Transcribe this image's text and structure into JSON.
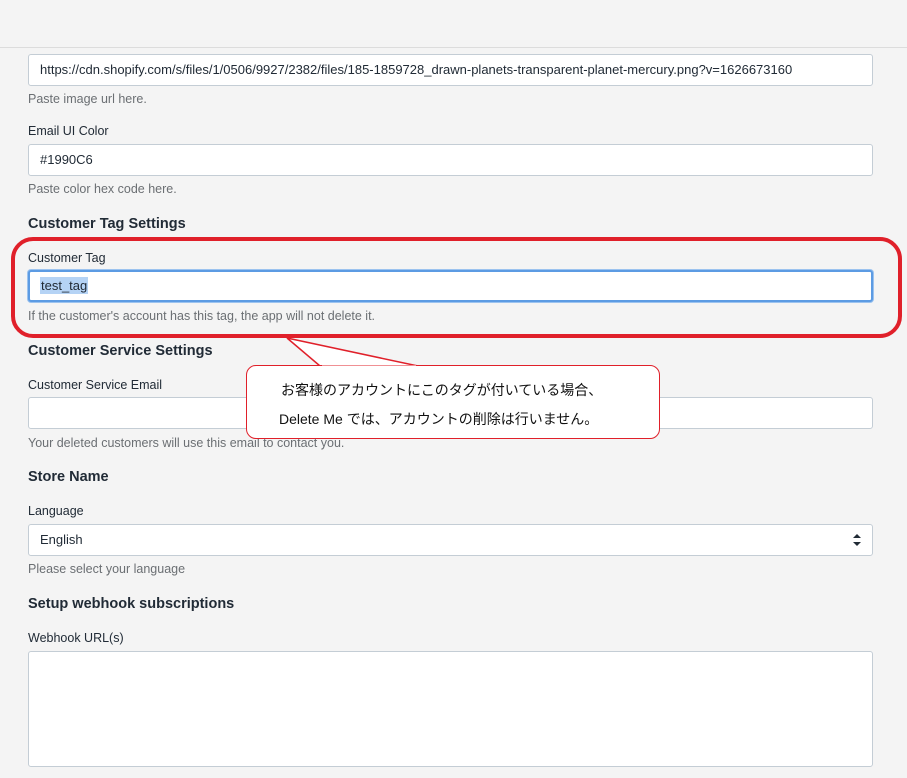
{
  "logo": {
    "url_value": "https://cdn.shopify.com/s/files/1/0506/9927/2382/files/185-1859728_drawn-planets-transparent-planet-mercury.png?v=1626673160",
    "url_help": "Paste image url here."
  },
  "email_ui_color": {
    "label": "Email UI Color",
    "value": "#1990C6",
    "help": "Paste color hex code here."
  },
  "customer_tag_settings": {
    "heading": "Customer Tag Settings",
    "label": "Customer Tag",
    "value": "test_tag",
    "help": "If the customer's account has this tag, the app will not delete it."
  },
  "customer_service_settings": {
    "heading": "Customer Service Settings",
    "label": "Customer Service Email",
    "value": "",
    "help": "Your deleted customers will use this email to contact you."
  },
  "store_name": {
    "heading": "Store Name",
    "language_label": "Language",
    "language_selected": "English",
    "language_help": "Please select your language"
  },
  "webhook": {
    "heading": "Setup webhook subscriptions",
    "label": "Webhook URL(s)",
    "value": ""
  },
  "annotation": {
    "line1": "お客様のアカウントにこのタグが付いている場合、",
    "line2": "Delete Me では、アカウントの削除は行いません。",
    "color": "#e0202a"
  },
  "colors": {
    "focus_border": "#5c9be3",
    "selection": "#b5d3f5",
    "background": "#f4f4f4"
  }
}
